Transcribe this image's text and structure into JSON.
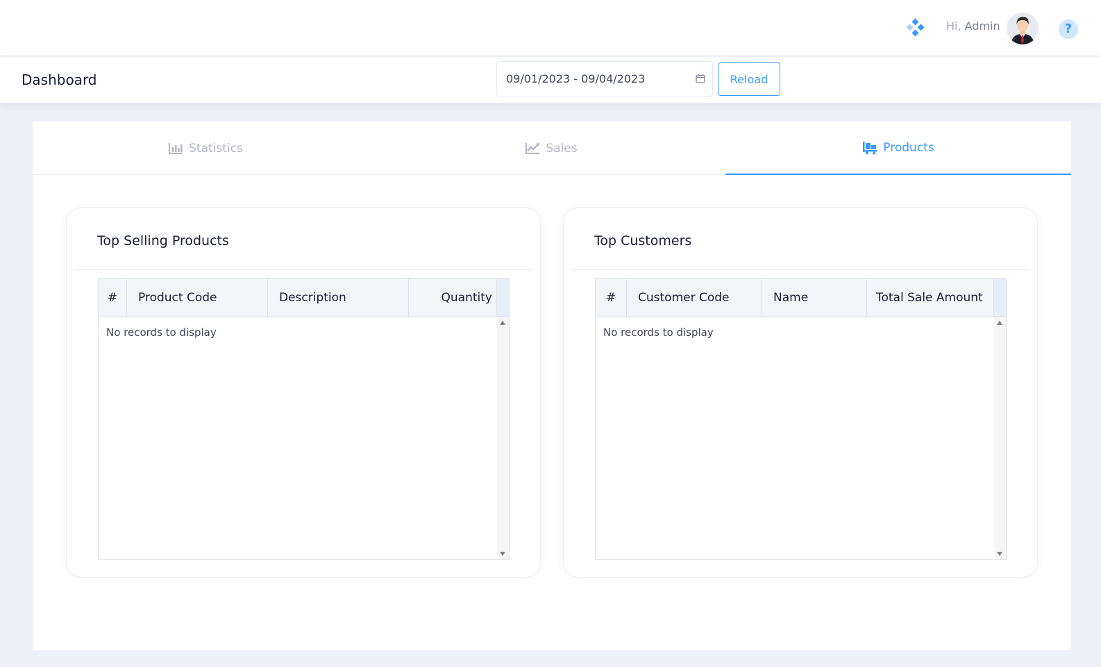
{
  "header": {
    "greeting": "Hi,",
    "username": "Admin",
    "quick_actions_icon": "grid-diamond-icon",
    "help_icon": "question-icon",
    "help_glyph": "?"
  },
  "subheader": {
    "title": "Dashboard",
    "date_range": "09/01/2023 - 09/04/2023",
    "reload_label": "Reload"
  },
  "tabs": [
    {
      "label": "Statistics",
      "icon": "bar-chart-icon",
      "active": false
    },
    {
      "label": "Sales",
      "icon": "line-chart-icon",
      "active": false
    },
    {
      "label": "Products",
      "icon": "pallet-boxes-icon",
      "active": true
    }
  ],
  "top_products": {
    "title": "Top Selling Products",
    "columns": [
      "#",
      "Product Code",
      "Description",
      "Quantity"
    ],
    "rows": [],
    "empty_text": "No records to display"
  },
  "top_customers": {
    "title": "Top Customers",
    "columns": [
      "#",
      "Customer Code",
      "Name",
      "Total Sale Amount"
    ],
    "rows": [],
    "empty_text": "No records to display"
  },
  "colors": {
    "accent": "#3699ff",
    "background": "#eef0f8",
    "muted_text": "#b5b5c3"
  }
}
